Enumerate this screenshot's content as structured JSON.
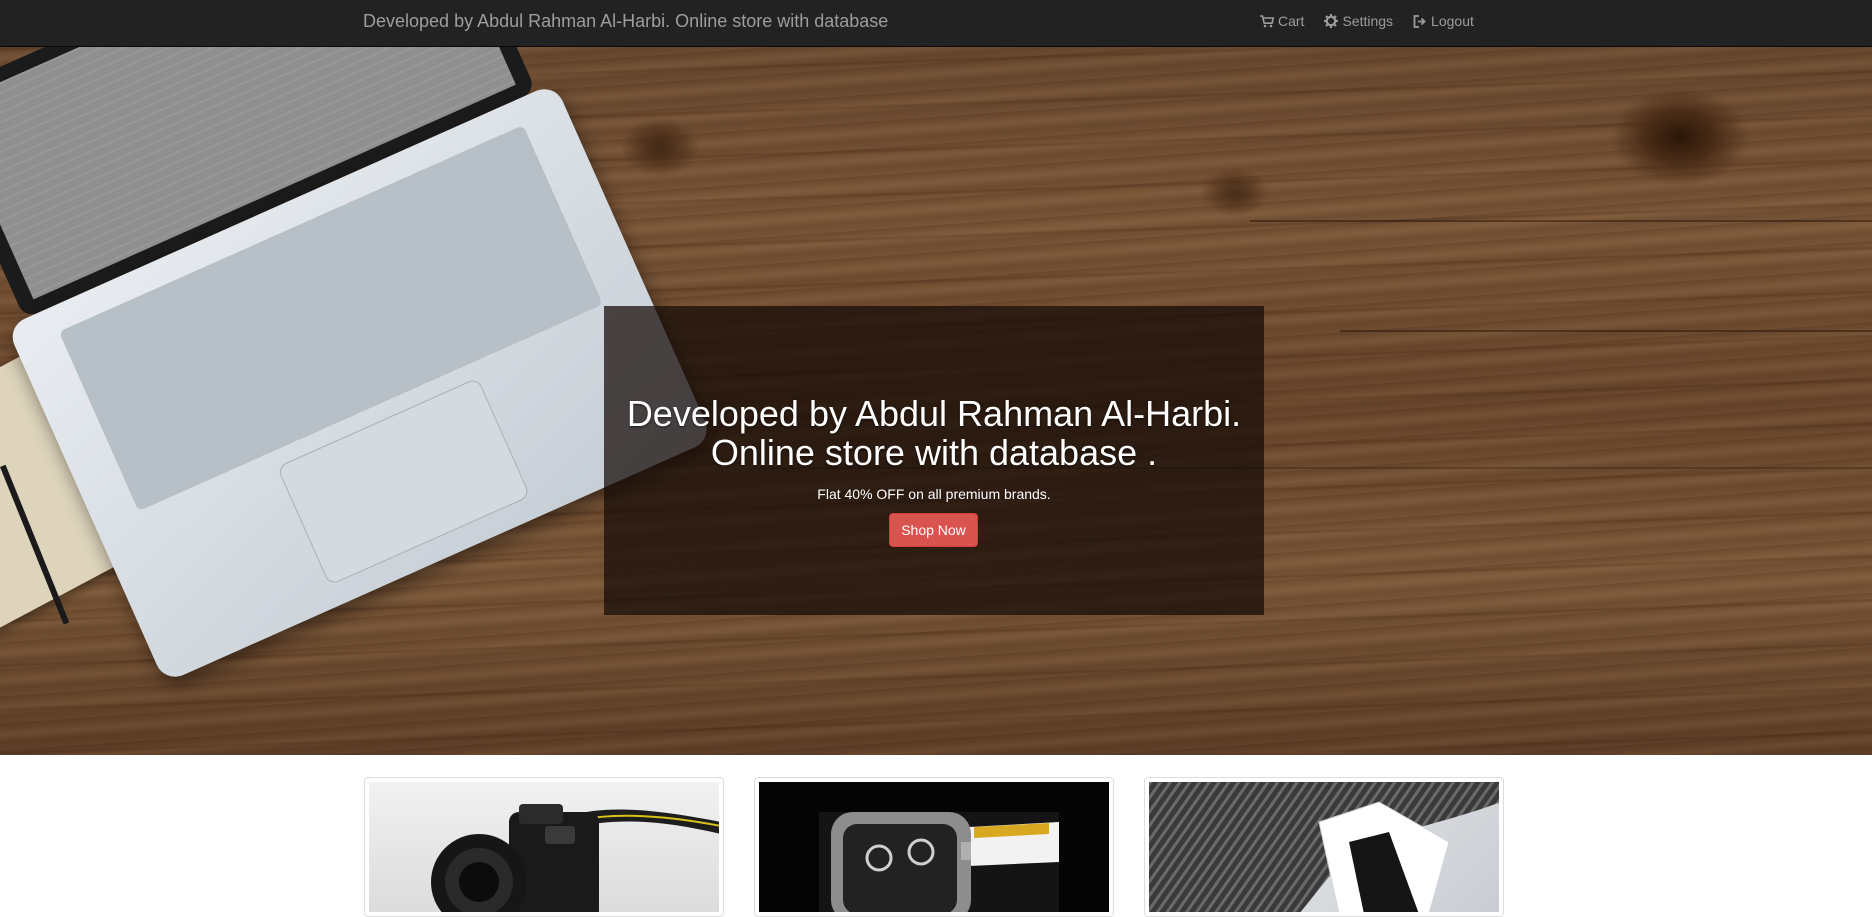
{
  "navbar": {
    "brand": "Developed by Abdul Rahman Al-Harbi. Online store with database",
    "items": [
      {
        "label": "Cart",
        "icon": "cart-icon"
      },
      {
        "label": "Settings",
        "icon": "gear-icon"
      },
      {
        "label": "Logout",
        "icon": "logout-icon"
      }
    ]
  },
  "hero": {
    "title_line1": "Developed by Abdul Rahman Al-Harbi.",
    "title_line2": "Online store with database .",
    "subtitle": "Flat 40% OFF on all premium brands.",
    "button_label": "Shop Now",
    "button_color": "#d9534f"
  },
  "products": [
    {
      "image": "camera-image"
    },
    {
      "image": "watch-image"
    },
    {
      "image": "shirt-image"
    }
  ],
  "colors": {
    "navbar_bg": "#222222",
    "navbar_text": "#9d9d9d",
    "accent": "#d9534f"
  }
}
